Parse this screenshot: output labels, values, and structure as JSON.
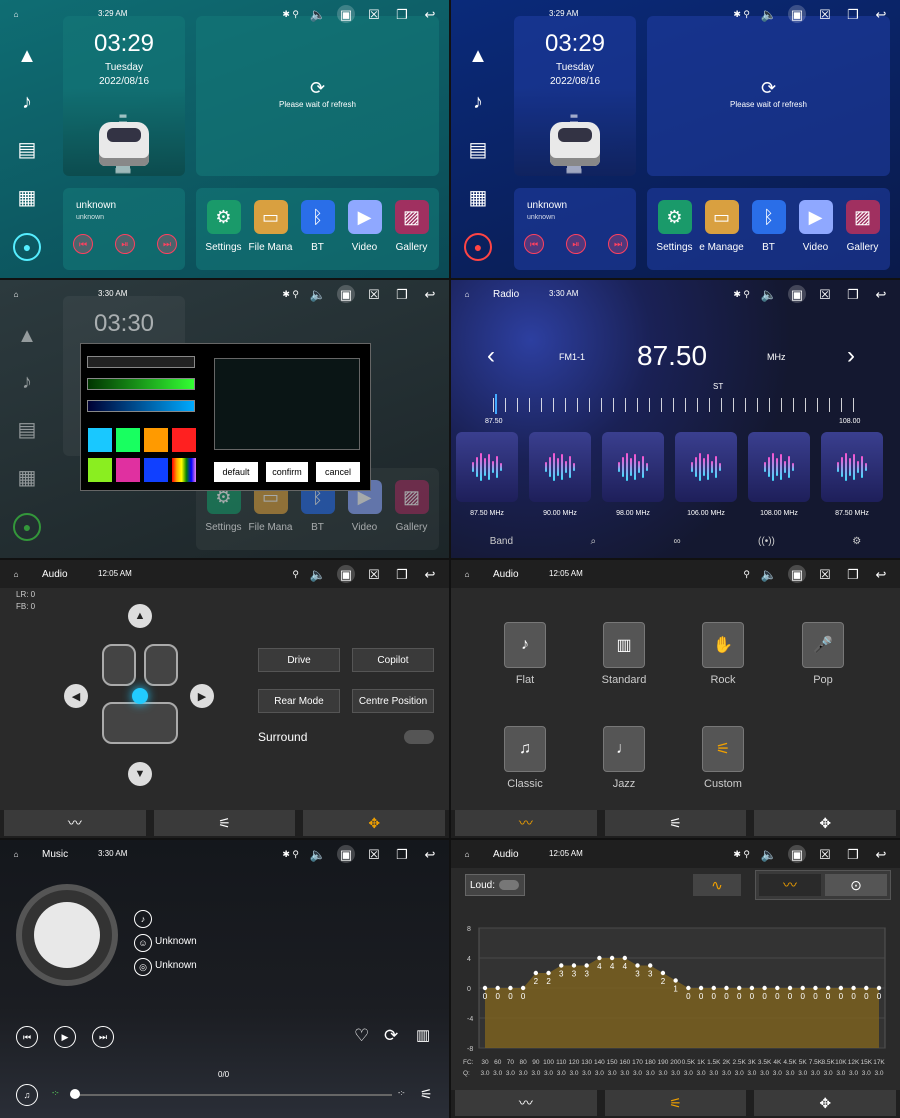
{
  "panels": {
    "home1": {
      "status": {
        "time": "3:29 AM"
      },
      "clock": {
        "time": "03:29",
        "day": "Tuesday",
        "date": "2022/08/16"
      },
      "map": {
        "wait": "Please wait of refresh"
      },
      "music": {
        "title": "unknown",
        "artist": "unknown"
      },
      "apps": [
        "Settings",
        "File Mana",
        "BT",
        "Video",
        "Gallery"
      ]
    },
    "home2": {
      "status": {
        "time": "3:29 AM"
      },
      "clock": {
        "time": "03:29",
        "day": "Tuesday",
        "date": "2022/08/16"
      },
      "map": {
        "wait": "Please wait of refresh"
      },
      "music": {
        "title": "unknown",
        "artist": "unknown"
      },
      "apps": [
        "Settings",
        "e Manage",
        "BT",
        "Video",
        "Gallery"
      ]
    },
    "theme": {
      "status": {
        "time": "3:30 AM"
      },
      "clock": {
        "time": "03:30"
      },
      "buttons": {
        "default": "default",
        "confirm": "confirm",
        "cancel": "cancel"
      },
      "apps": [
        "Settings",
        "File Mana",
        "BT",
        "Video",
        "Gallery"
      ],
      "swatches": [
        "#19c8ff",
        "#18ff60",
        "#ff9a00",
        "#ff2020",
        "#8aee20",
        "#e030a0",
        "#1040ff",
        "rainbow"
      ]
    },
    "radio": {
      "status": {
        "title": "Radio",
        "time": "3:30 AM"
      },
      "band_label": "FM1-1",
      "frequency": "87.50",
      "unit": "MHz",
      "stereo": "ST",
      "scale_min": "87.50",
      "scale_max": "108.00",
      "presets": [
        "87.50 MHz",
        "90.00 MHz",
        "98.00 MHz",
        "106.00 MHz",
        "108.00 MHz",
        "87.50 MHz"
      ],
      "bottom": {
        "band": "Band"
      }
    },
    "audio_balance": {
      "status": {
        "title": "Audio",
        "time": "12:05 AM"
      },
      "lr": "LR: 0",
      "fb": "FB: 0",
      "buttons": {
        "drive": "Drive",
        "copilot": "Copilot",
        "rear": "Rear Mode",
        "centre": "Centre Position"
      },
      "surround": "Surround"
    },
    "audio_presets": {
      "status": {
        "title": "Audio",
        "time": "12:05 AM"
      },
      "presets": [
        "Flat",
        "Standard",
        "Rock",
        "Pop",
        "Classic",
        "Jazz",
        "Custom"
      ]
    },
    "music": {
      "status": {
        "title": "Music",
        "time": "3:30 AM"
      },
      "artist": "Unknown",
      "album": "Unknown",
      "progress_label": "0/0",
      "elapsed": "-:-",
      "remaining": "-:-"
    },
    "eq": {
      "status": {
        "title": "Audio",
        "time": "12:05 AM"
      },
      "loud": "Loud:"
    }
  },
  "chart_data": {
    "type": "line",
    "ylim": [
      -8,
      8
    ],
    "yticks": [
      "8",
      "4",
      "0",
      "-4",
      "-8"
    ],
    "fc_label": "FC:",
    "q_label": "Q:",
    "x": [
      "30",
      "60",
      "70",
      "80",
      "90",
      "100",
      "110",
      "120",
      "130",
      "140",
      "150",
      "160",
      "170",
      "180",
      "190",
      "200",
      "0.5K",
      "1K",
      "1.5K",
      "2K",
      "2.5K",
      "3K",
      "3.5K",
      "4K",
      "4.5K",
      "5K",
      "7.5K",
      "8.5K",
      "10K",
      "12K",
      "15K",
      "17K"
    ],
    "values": [
      0,
      0,
      0,
      0,
      2,
      2,
      3,
      3,
      3,
      4,
      4,
      4,
      3,
      3,
      2,
      1,
      0,
      0,
      0,
      0,
      0,
      0,
      0,
      0,
      0,
      0,
      0,
      0,
      0,
      0,
      0,
      0
    ],
    "q": [
      "3.0",
      "3.0",
      "3.0",
      "3.0",
      "3.0",
      "3.0",
      "3.0",
      "3.0",
      "3.0",
      "3.0",
      "3.0",
      "3.0",
      "3.0",
      "3.0",
      "3.0",
      "3.0",
      "3.0",
      "3.0",
      "3.0",
      "3.0",
      "3.0",
      "3.0",
      "3.0",
      "3.0",
      "3.0",
      "3.0",
      "3.0",
      "3.0",
      "3.0",
      "3.0",
      "3.0",
      "3.0"
    ],
    "fill_color": "#7a6020",
    "point_color": "#ffffff"
  }
}
